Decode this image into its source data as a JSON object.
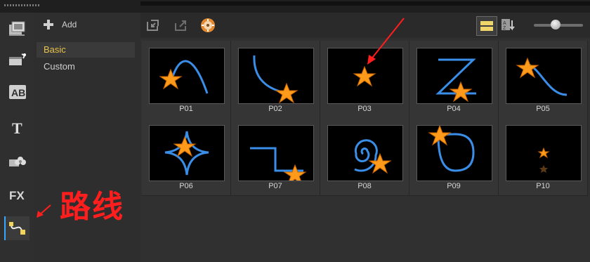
{
  "category_panel": {
    "add_label": "Add",
    "items": [
      {
        "label": "Basic",
        "selected": true
      },
      {
        "label": "Custom",
        "selected": false
      }
    ]
  },
  "left_toolbar": {
    "icons": [
      "media-icon",
      "instant-project-icon",
      "title-ab-icon",
      "text-t-icon",
      "graphics-icon",
      "fx-icon",
      "path-icon"
    ],
    "fx_label": "FX",
    "ab_label": "AB",
    "t_label": "T",
    "active": "path-icon"
  },
  "presets": [
    {
      "label": "P01"
    },
    {
      "label": "P02"
    },
    {
      "label": "P03"
    },
    {
      "label": "P04"
    },
    {
      "label": "P05"
    },
    {
      "label": "P06"
    },
    {
      "label": "P07"
    },
    {
      "label": "P08"
    },
    {
      "label": "P09"
    },
    {
      "label": "P10"
    }
  ],
  "annotation": {
    "text": "路线",
    "color": "#ff1e1e"
  },
  "colors": {
    "accent": "#36a6ff",
    "selected_text": "#e8c24a",
    "star": "#ff9a1a",
    "path": "#3a8ee8"
  }
}
